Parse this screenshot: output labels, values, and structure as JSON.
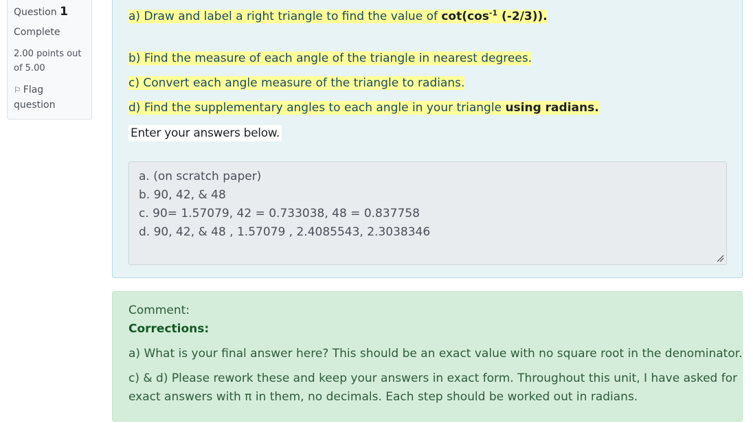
{
  "info": {
    "question_label": "Question",
    "question_number": "1",
    "state": "Complete",
    "grade_line1": "2.00 points out",
    "grade_line2": "of 5.00",
    "flag_line1": "Flag",
    "flag_line2": "question"
  },
  "question": {
    "part_a": {
      "text": "a) Draw and label a right triangle to find the value of ",
      "bold": "cot(cos",
      "sup": "-1",
      "bold_end": " (-2/3))."
    },
    "part_b": "b) Find the measure of each angle of the triangle in nearest degrees.",
    "part_c": "c) Convert each angle measure of the triangle to radians.",
    "part_d": {
      "text": "d) Find the supplementary angles to each angle in your triangle ",
      "bold": "using radians."
    },
    "enter_label": "Enter your answers below."
  },
  "answer": {
    "lines": [
      "a. (on scratch paper)",
      "b. 90, 42, & 48",
      "c. 90= 1.57079, 42 = 0.733038,  48 = 0.837758",
      "d. 90, 42, & 48 , 1.57079 , 2.4085543, 2.3038346"
    ]
  },
  "comment": {
    "label": "Comment:",
    "heading": "Corrections:",
    "para1": "a) What is your final answer here? This should be an exact value with no square root in the denominator.",
    "para2_line1": "c) & d) Please rework these and keep your answers in exact form. Throughout this unit, I have asked for",
    "para2_line2": "exact answers with π in them, no decimals. Each step should be worked out in radians."
  },
  "colors": {
    "highlight": "#ffff99",
    "question_bg": "#e7f3f5",
    "comment_bg": "#d4edda"
  }
}
